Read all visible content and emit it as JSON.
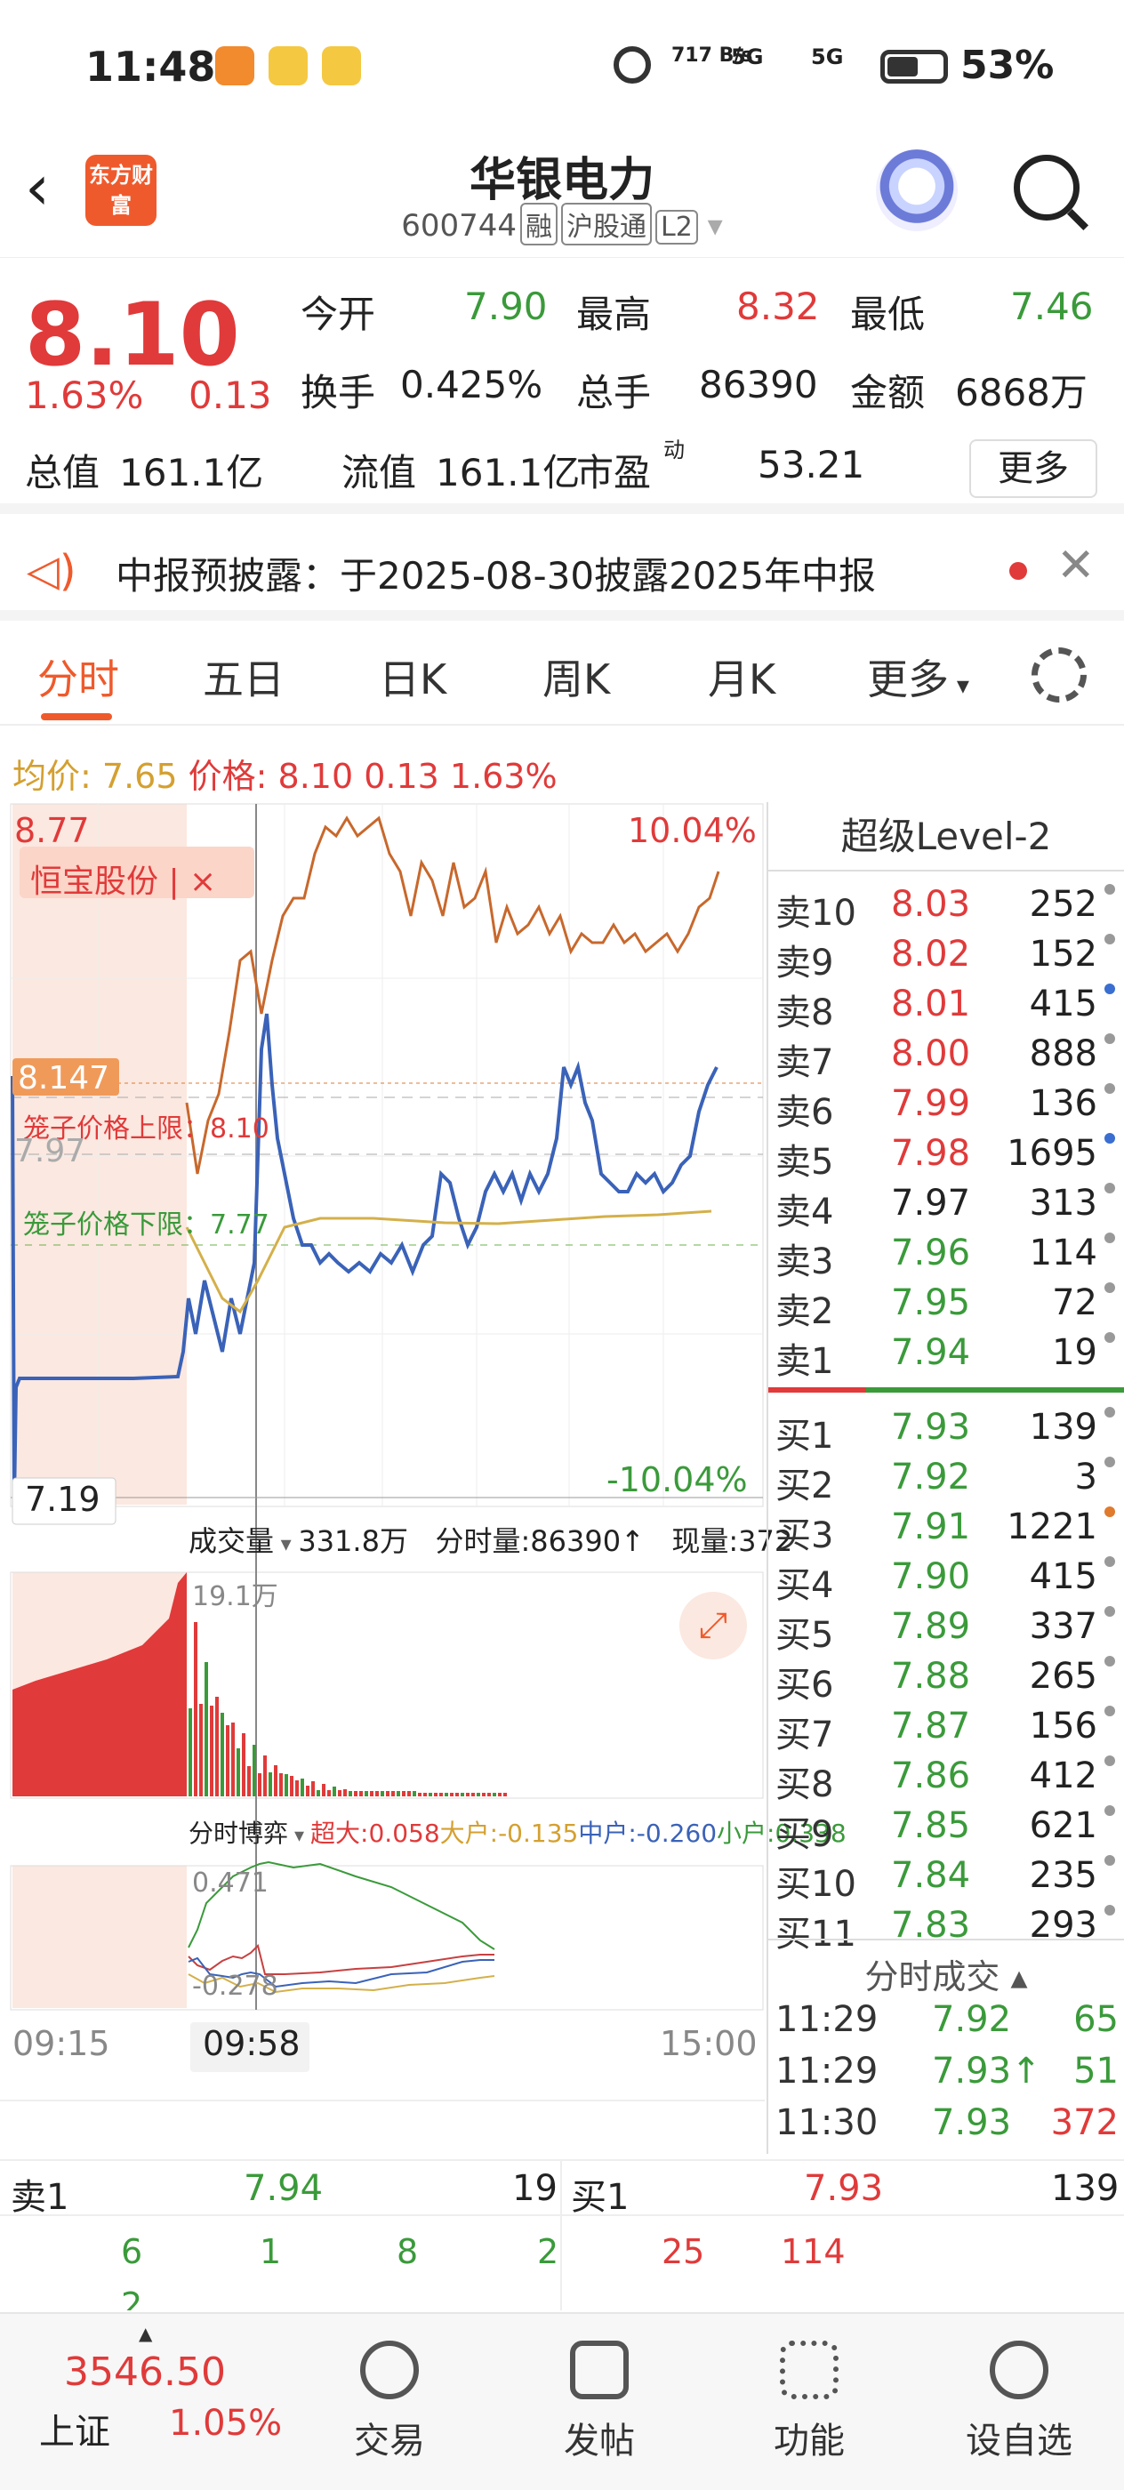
{
  "status": {
    "time": "11:48",
    "net": "717 B/s",
    "sig1": "5G",
    "sig2": "5G",
    "battery": "53%"
  },
  "header": {
    "title": "华银电力",
    "code": "600744",
    "tags": [
      "融",
      "沪股通",
      "L2"
    ],
    "logo": "东方财富"
  },
  "quote": {
    "price": "8.10",
    "pct": "1.63%",
    "chg": "0.13",
    "open_l": "今开",
    "open": "7.90",
    "high_l": "最高",
    "high": "8.32",
    "low_l": "最低",
    "low": "7.46",
    "turn_l": "换手",
    "turn": "0.425%",
    "vol_l": "总手",
    "vol": "86390",
    "amt_l": "金额",
    "amt": "6868万",
    "mcap_l": "总值",
    "mcap": "161.1亿",
    "fcap_l": "流值",
    "fcap": "161.1亿",
    "pe_l": "市盈",
    "pe_sup": "动",
    "pe": "53.21",
    "more": "更多"
  },
  "notice": {
    "text": "中报预披露：于2025-08-30披露2025年中报"
  },
  "tabs": [
    "分时",
    "五日",
    "日K",
    "周K",
    "月K",
    "更多"
  ],
  "avg": {
    "label1": "均价:",
    "avg": "7.65",
    "label2": "价格:",
    "price": "8.10",
    "chg": "0.13",
    "pct": "1.63%"
  },
  "chart": {
    "top_price": "8.77",
    "top_pct": "10.04%",
    "bottom_price": "7.19",
    "bottom_pct": "-10.04%",
    "marker": "8.147",
    "ref": "7.97",
    "related": "恒宝股份 | ×",
    "cage_up": "笼子价格上限：8.10",
    "cage_down": "笼子价格下限：7.77",
    "vol_title": "成交量",
    "vol_total": "331.8万",
    "vol_tick": "分时量:86390↑",
    "vol_now": "现量:372",
    "vol_max": "19.1万",
    "game_title": "分时博弈",
    "g_super": "超大:0.058",
    "g_big": "大户:-0.135",
    "g_mid": "中户:-0.260",
    "g_small": "小户:0.338",
    "g_top": "0.471",
    "g_bot": "-0.278",
    "t_start": "09:15",
    "t_cursor": "09:58",
    "t_end": "15:00"
  },
  "orderbook": {
    "title": "超级Level-2",
    "asks": [
      {
        "l": "卖10",
        "p": "8.03",
        "v": "252",
        "c": "#999"
      },
      {
        "l": "卖9",
        "p": "8.02",
        "v": "152",
        "c": "#999"
      },
      {
        "l": "卖8",
        "p": "8.01",
        "v": "415",
        "c": "#3a6ed0"
      },
      {
        "l": "卖7",
        "p": "8.00",
        "v": "888",
        "c": "#999"
      },
      {
        "l": "卖6",
        "p": "7.99",
        "v": "136",
        "c": "#999"
      },
      {
        "l": "卖5",
        "p": "7.98",
        "v": "1695",
        "c": "#3a6ed0"
      },
      {
        "l": "卖4",
        "p": "7.97",
        "v": "313",
        "c": "#999"
      },
      {
        "l": "卖3",
        "p": "7.96",
        "v": "114",
        "c": "#999"
      },
      {
        "l": "卖2",
        "p": "7.95",
        "v": "72",
        "c": "#999"
      },
      {
        "l": "卖1",
        "p": "7.94",
        "v": "19",
        "c": "#999"
      }
    ],
    "bids": [
      {
        "l": "买1",
        "p": "7.93",
        "v": "139",
        "c": "#999"
      },
      {
        "l": "买2",
        "p": "7.92",
        "v": "3",
        "c": "#999"
      },
      {
        "l": "买3",
        "p": "7.91",
        "v": "1221",
        "c": "#e07a2c"
      },
      {
        "l": "买4",
        "p": "7.90",
        "v": "415",
        "c": "#999"
      },
      {
        "l": "买5",
        "p": "7.89",
        "v": "337",
        "c": "#999"
      },
      {
        "l": "买6",
        "p": "7.88",
        "v": "265",
        "c": "#999"
      },
      {
        "l": "买7",
        "p": "7.87",
        "v": "156",
        "c": "#999"
      },
      {
        "l": "买8",
        "p": "7.86",
        "v": "412",
        "c": "#999"
      },
      {
        "l": "买9",
        "p": "7.85",
        "v": "621",
        "c": "#999"
      },
      {
        "l": "买10",
        "p": "7.84",
        "v": "235",
        "c": "#999"
      },
      {
        "l": "买11",
        "p": "7.83",
        "v": "293",
        "c": "#999"
      }
    ],
    "ticks_title": "分时成交",
    "ticks": [
      {
        "t": "11:29",
        "p": "7.92",
        "v": "65"
      },
      {
        "t": "11:29",
        "p": "7.93↑",
        "v": "51"
      },
      {
        "t": "11:30",
        "p": "7.93",
        "v": "372"
      }
    ]
  },
  "bottom": {
    "sell_l": "卖1",
    "sell_p": "7.94",
    "sell_v": "19",
    "buy_l": "买1",
    "buy_p": "7.93",
    "buy_v": "139",
    "sell_q": [
      "6",
      "1",
      "8",
      "2",
      "2"
    ],
    "buy_q": [
      "25",
      "114"
    ]
  },
  "nav": {
    "index_val": "3546.50",
    "index_name": "上证",
    "index_pct": "1.05%",
    "items": [
      "交易",
      "发帖",
      "功能",
      "设自选"
    ]
  },
  "colors": {
    "accent": "#ef5a2c",
    "up": "#e03a3a",
    "down": "#3a9a3a",
    "price_line": "#3a62b8",
    "avg_line": "#d4b04a"
  }
}
